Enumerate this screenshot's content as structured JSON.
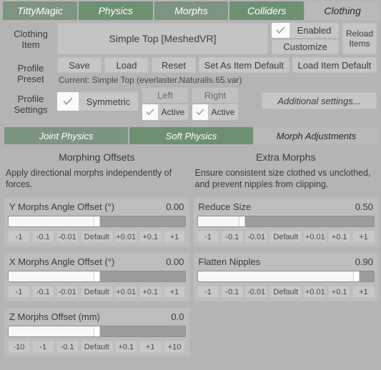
{
  "tabs": [
    {
      "label": "TittyMagic",
      "active": false
    },
    {
      "label": "Physics",
      "active": false
    },
    {
      "label": "Morphs",
      "active": false
    },
    {
      "label": "Colliders",
      "active": false
    },
    {
      "label": "Clothing",
      "active": true
    }
  ],
  "clothing_item": {
    "label_line1": "Clothing",
    "label_line2": "Item",
    "value": "Simple Top [MeshedVR]",
    "enabled_label": "Enabled",
    "enabled_checked": true,
    "customize_label": "Customize",
    "reload_line1": "Reload",
    "reload_line2": "Items"
  },
  "profile_preset": {
    "label_line1": "Profile",
    "label_line2": "Preset",
    "save_label": "Save",
    "load_label": "Load",
    "reset_label": "Reset",
    "set_default_label": "Set As Item Default",
    "load_default_label": "Load Item Default",
    "current_text": "Current: Simple Top (everlaster.Naturalis.65.var)"
  },
  "profile_settings": {
    "label_line1": "Profile",
    "label_line2": "Settings",
    "symmetric_label": "Symmetric",
    "symmetric_checked": true,
    "left_header": "Left",
    "left_active_label": "Active",
    "left_active_checked": true,
    "right_header": "Right",
    "right_active_label": "Active",
    "right_active_checked": true,
    "additional_settings_label": "Additional settings..."
  },
  "subtabs": [
    {
      "label": "Joint Physics",
      "active": false
    },
    {
      "label": "Soft Physics",
      "active": false
    },
    {
      "label": "Morph Adjustments",
      "active": true
    }
  ],
  "left_column": {
    "title": "Morphing Offsets",
    "description": "Apply directional morphs independently of forces.",
    "sliders": [
      {
        "name": "Y Morphs Angle Offset (°)",
        "value": "0.00",
        "percent": 50,
        "steps": [
          "-1",
          "-0.1",
          "-0.01",
          "Default",
          "+0.01",
          "+0.1",
          "+1"
        ]
      },
      {
        "name": "X Morphs Angle Offset (°)",
        "value": "0.00",
        "percent": 50,
        "steps": [
          "-1",
          "-0.1",
          "-0.01",
          "Default",
          "+0.01",
          "+0.1",
          "+1"
        ]
      },
      {
        "name": "Z Morphs Offset (mm)",
        "value": "0.0",
        "percent": 50,
        "steps": [
          "-10",
          "-1",
          "-0.1",
          "Default",
          "+0.1",
          "+1",
          "+10"
        ]
      }
    ]
  },
  "right_column": {
    "title": "Extra Morphs",
    "description": "Ensure consistent size clothed vs unclothed, and prevent nipples from clipping.",
    "sliders": [
      {
        "name": "Reduce Size",
        "value": "0.50",
        "percent": 25,
        "steps": [
          "-1",
          "-0.1",
          "-0.01",
          "Default",
          "+0.01",
          "+0.1",
          "+1"
        ]
      },
      {
        "name": "Flatten Nipples",
        "value": "0.90",
        "percent": 90,
        "steps": [
          "-1",
          "-0.1",
          "-0.01",
          "Default",
          "+0.01",
          "+0.1",
          "+1"
        ]
      }
    ]
  },
  "colors": {
    "tab_green": "#7d9480",
    "tab_green_alt": "#6d9072",
    "background": "#b4b4b4",
    "panel": "#bdbdbd",
    "slider_fill": "#f7f7f7"
  }
}
